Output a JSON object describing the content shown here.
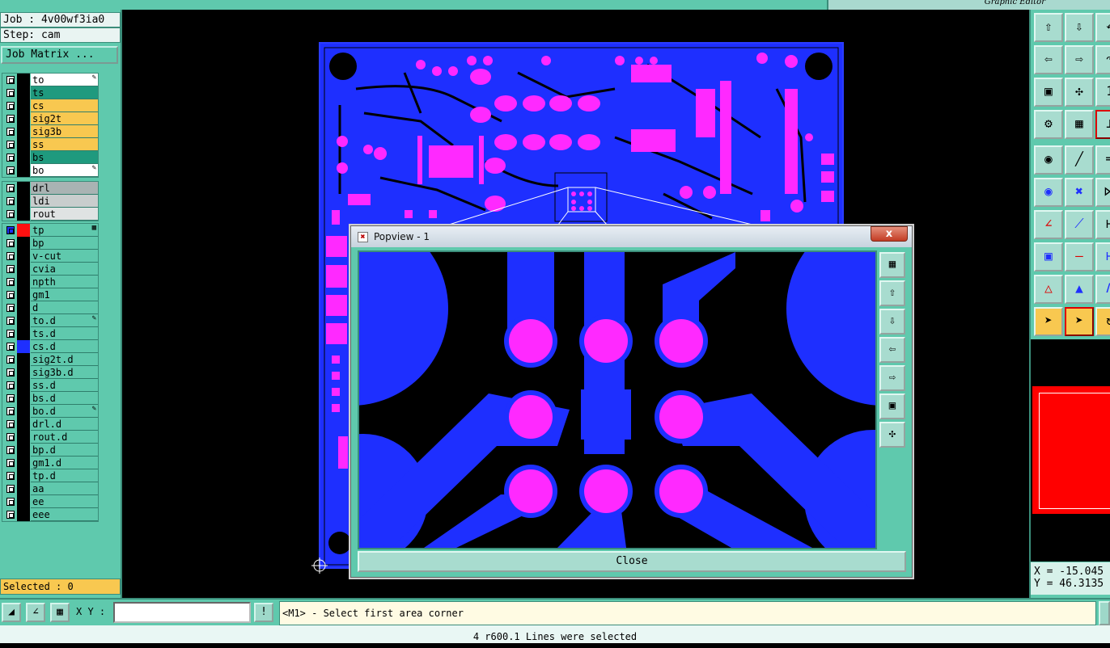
{
  "app": {
    "title": "Graphic Editor"
  },
  "job": {
    "label": "Job : 4v00wf3ia0",
    "step_label": "Step: cam",
    "matrix_button": "Job Matrix ..."
  },
  "colors": {
    "panel": "#5fc9ad",
    "layer_signal": "#1e2fff",
    "pad": "#ff29ff",
    "selected_bg": "#f8c850",
    "board_top": "#ff0000"
  },
  "layers_board": [
    {
      "name": "to",
      "color": "#ffffff",
      "icon": "pen-icon"
    },
    {
      "name": "ts",
      "color": "#1f9a7e"
    },
    {
      "name": "cs",
      "color": "#f8c850"
    },
    {
      "name": "sig2t",
      "color": "#f8c850"
    },
    {
      "name": "sig3b",
      "color": "#f8c850"
    },
    {
      "name": "ss",
      "color": "#f8c850"
    },
    {
      "name": "bs",
      "color": "#1f9a7e"
    },
    {
      "name": "bo",
      "color": "#ffffff",
      "icon": "pen-icon"
    }
  ],
  "layers_drill": [
    {
      "name": "drl",
      "color": "#a9b3b3"
    },
    {
      "name": "ldi",
      "color": "#c8cdcd"
    },
    {
      "name": "rout",
      "color": "#dfe3e3"
    }
  ],
  "layers_misc": [
    {
      "name": "tp",
      "color": "#5fc9ad",
      "swatch": "#ff1010",
      "checked": true,
      "icon": "grid-icon"
    },
    {
      "name": "bp",
      "color": "#5fc9ad"
    },
    {
      "name": "v-cut",
      "color": "#5fc9ad"
    },
    {
      "name": "cvia",
      "color": "#5fc9ad"
    },
    {
      "name": "npth",
      "color": "#5fc9ad"
    },
    {
      "name": "gm1",
      "color": "#5fc9ad"
    },
    {
      "name": "d",
      "color": "#5fc9ad"
    },
    {
      "name": "to.d",
      "color": "#5fc9ad",
      "icon": "pen-icon"
    },
    {
      "name": "ts.d",
      "color": "#5fc9ad"
    },
    {
      "name": "cs.d",
      "color": "#5fc9ad",
      "swatch": "#1e2fff"
    },
    {
      "name": "sig2t.d",
      "color": "#5fc9ad"
    },
    {
      "name": "sig3b.d",
      "color": "#5fc9ad"
    },
    {
      "name": "ss.d",
      "color": "#5fc9ad"
    },
    {
      "name": "bs.d",
      "color": "#5fc9ad"
    },
    {
      "name": "bo.d",
      "color": "#5fc9ad",
      "icon": "pen-icon"
    },
    {
      "name": "drl.d",
      "color": "#5fc9ad"
    },
    {
      "name": "rout.d",
      "color": "#5fc9ad"
    },
    {
      "name": "bp.d",
      "color": "#5fc9ad"
    },
    {
      "name": "gm1.d",
      "color": "#5fc9ad"
    },
    {
      "name": "tp.d",
      "color": "#5fc9ad"
    },
    {
      "name": "aa",
      "color": "#5fc9ad"
    },
    {
      "name": "ee",
      "color": "#5fc9ad"
    },
    {
      "name": "eee",
      "color": "#5fc9ad"
    }
  ],
  "selected_label": "Selected : 0",
  "bottom": {
    "xy_label": "X Y :",
    "xy_value": "",
    "exclaim": "!",
    "prompt": "<M1> - Select first area corner"
  },
  "status": "4 r600.1 Lines were selected",
  "coords": {
    "x": "X = -15.045",
    "y": "Y = 46.3135"
  },
  "popup": {
    "title": "Popview - 1",
    "close_x": "x",
    "close_button": "Close"
  }
}
